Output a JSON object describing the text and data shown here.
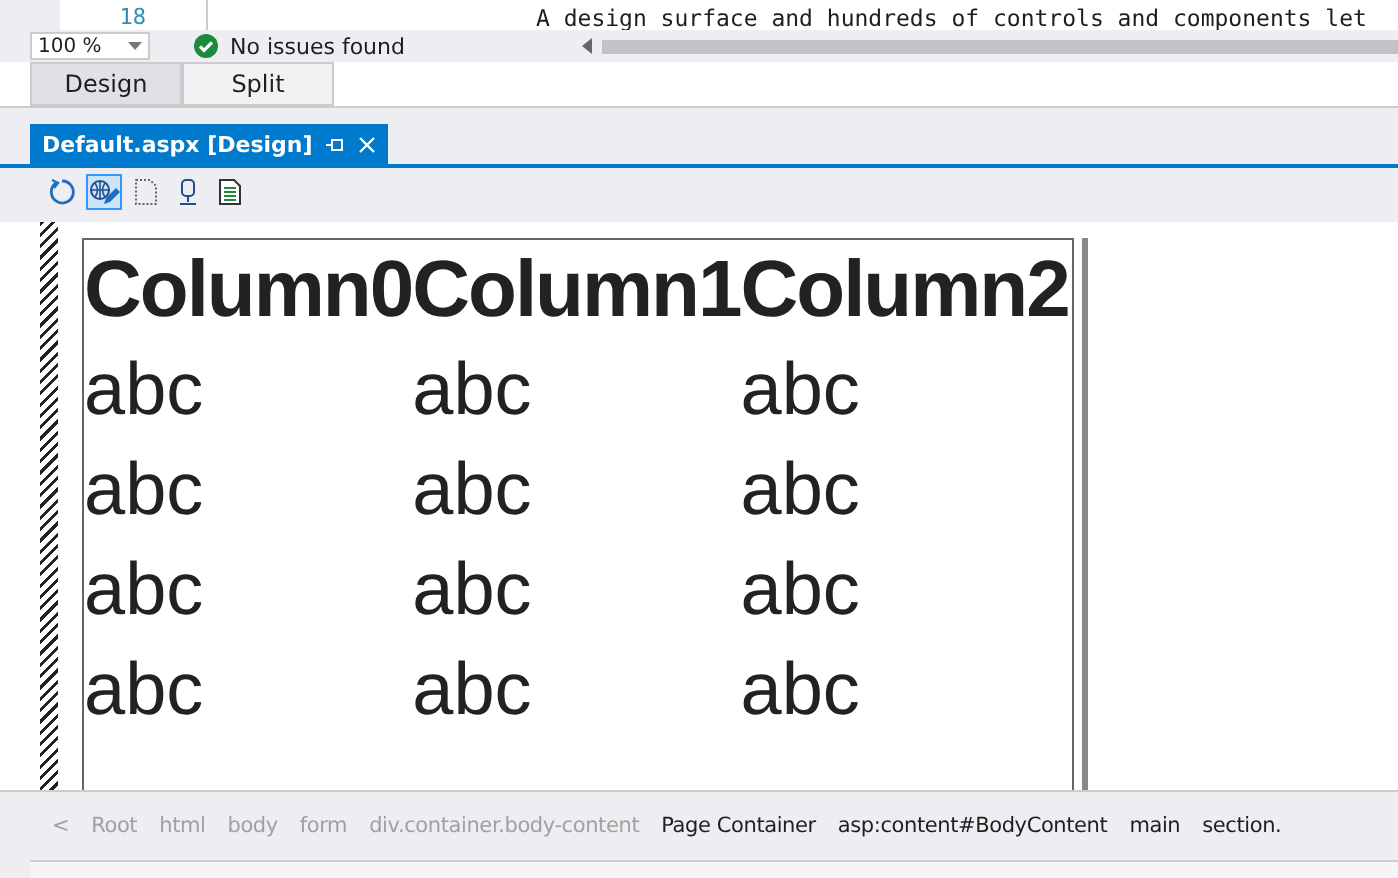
{
  "code_editor": {
    "lines": [
      {
        "number": "18",
        "text": "A design surface and hundreds of controls and components let"
      }
    ]
  },
  "status": {
    "zoom": "100 %",
    "issues": "No issues found"
  },
  "view_buttons": [
    {
      "label": "Design",
      "selected": true
    },
    {
      "label": "Split",
      "selected": false
    }
  ],
  "document_tab": {
    "title": "Default.aspx [Design]",
    "selected": true
  },
  "toolbar": [
    {
      "kind": "refresh",
      "selected": false
    },
    {
      "kind": "globe-edit",
      "selected": true
    },
    {
      "kind": "page",
      "selected": false
    },
    {
      "kind": "database",
      "selected": false
    },
    {
      "kind": "document",
      "selected": false
    }
  ],
  "table": {
    "columns": [
      "Column0",
      "Column1",
      "Column2"
    ],
    "rows": [
      [
        "abc",
        "abc",
        "abc"
      ],
      [
        "abc",
        "abc",
        "abc"
      ],
      [
        "abc",
        "abc",
        "abc"
      ],
      [
        "abc",
        "abc",
        "abc"
      ]
    ]
  },
  "breadcrumbs": [
    {
      "label": "<",
      "disabled": true
    },
    {
      "label": "Root",
      "disabled": true
    },
    {
      "label": "html",
      "disabled": true
    },
    {
      "label": "body",
      "disabled": true
    },
    {
      "label": "form",
      "disabled": true
    },
    {
      "label": "div.container.body-content",
      "disabled": true
    },
    {
      "label": "Page Container",
      "disabled": false
    },
    {
      "label": "asp:content#BodyContent",
      "disabled": false
    },
    {
      "label": "main",
      "disabled": false
    },
    {
      "label": "section.",
      "disabled": false
    }
  ]
}
